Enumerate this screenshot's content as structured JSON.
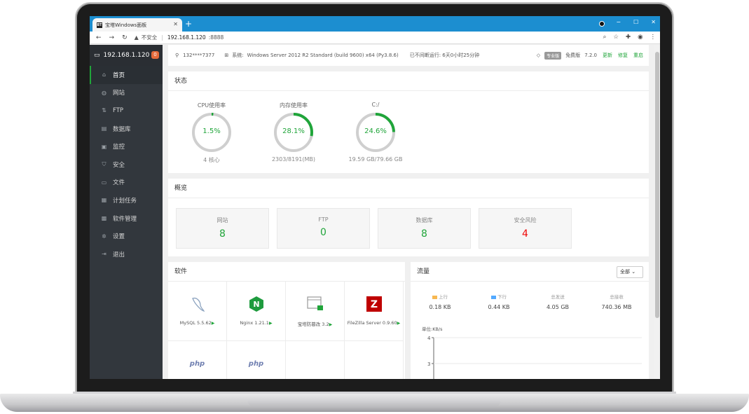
{
  "browser": {
    "tab_title": "宝塔Windows面板",
    "favicon": "BT",
    "new_tab": "+",
    "security_label": "不安全",
    "url_host": "192.168.1.120",
    "url_port": ":8888",
    "win_min": "−",
    "win_max": "☐",
    "win_close": "✕"
  },
  "sidebar": {
    "server": "192.168.1.120",
    "badge": "0",
    "items": [
      {
        "label": "首页",
        "icon": "home-icon"
      },
      {
        "label": "网站",
        "icon": "globe-icon"
      },
      {
        "label": "FTP",
        "icon": "ftp-icon"
      },
      {
        "label": "数据库",
        "icon": "database-icon"
      },
      {
        "label": "监控",
        "icon": "monitor-icon"
      },
      {
        "label": "安全",
        "icon": "shield-icon"
      },
      {
        "label": "文件",
        "icon": "folder-icon"
      },
      {
        "label": "计划任务",
        "icon": "calendar-icon"
      },
      {
        "label": "软件管理",
        "icon": "apps-icon"
      },
      {
        "label": "设置",
        "icon": "gear-icon"
      },
      {
        "label": "退出",
        "icon": "logout-icon"
      }
    ]
  },
  "topinfo": {
    "user": "132****7377",
    "system_label": "系统:",
    "system": "Windows Server 2012 R2 Standard (build 9600) x64 (Py3.8.6)",
    "uptime": "已不间断运行: 6天0小时25分钟",
    "pro_tag": "专业版",
    "edition": "免费版",
    "version": "7.2.0",
    "update": "更新",
    "repair": "修复",
    "restart": "重启"
  },
  "status": {
    "title": "状态",
    "gauges": [
      {
        "label": "CPU使用率",
        "value": "1.5%",
        "percent": 1.5,
        "sub": "4 核心"
      },
      {
        "label": "内存使用率",
        "value": "28.1%",
        "percent": 28.1,
        "sub": "2303/8191(MB)"
      },
      {
        "label": "C:/",
        "value": "24.6%",
        "percent": 24.6,
        "sub": "19.59 GB/79.66 GB"
      }
    ]
  },
  "overview": {
    "title": "概览",
    "cards": [
      {
        "label": "网站",
        "value": "8"
      },
      {
        "label": "FTP",
        "value": "0"
      },
      {
        "label": "数据库",
        "value": "8"
      },
      {
        "label": "安全风险",
        "value": "4"
      }
    ]
  },
  "software": {
    "title": "软件",
    "items": [
      {
        "name": "MySQL 5.5.62",
        "play": "▶"
      },
      {
        "name": "Nginx 1.21.1",
        "play": "▶"
      },
      {
        "name": "宝塔防篡改 3.2",
        "play": "▶"
      },
      {
        "name": "FileZilla Server 0.9.60",
        "play": "▶"
      },
      {
        "php": "php"
      },
      {
        "php": "php"
      }
    ]
  },
  "traffic": {
    "title": "流量",
    "select": "全部",
    "stats": [
      {
        "label": "上行",
        "value": "0.18 KB",
        "color": "#f7b851"
      },
      {
        "label": "下行",
        "value": "0.44 KB",
        "color": "#52a9ff"
      },
      {
        "label": "总发送",
        "value": "4.05 GB"
      },
      {
        "label": "总接收",
        "value": "740.36 MB"
      }
    ],
    "unit": "单位:KB/s",
    "y_ticks": [
      "4",
      "3"
    ]
  }
}
